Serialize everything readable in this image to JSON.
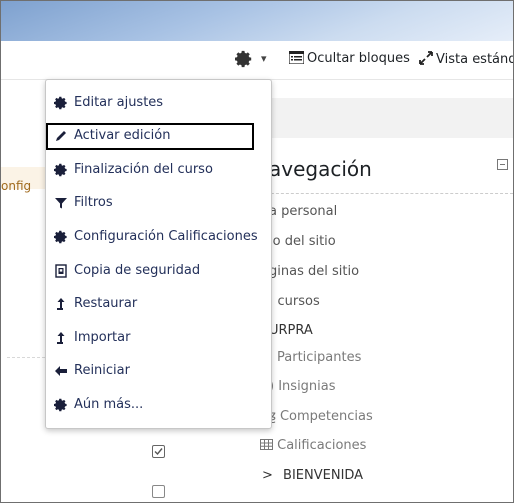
{
  "toolbar": {
    "gear_icon": "gear-icon",
    "hide_blocks_label": "Ocultar bloques",
    "standard_view_label": "Vista estánda"
  },
  "left": {
    "config_fragment": "onfig"
  },
  "menu": {
    "items": [
      {
        "icon": "gear-icon",
        "label": "Editar ajustes"
      },
      {
        "icon": "pencil-icon",
        "label": "Activar edición"
      },
      {
        "icon": "gear-icon",
        "label": "Finalización del curso"
      },
      {
        "icon": "filter-icon",
        "label": "Filtros"
      },
      {
        "icon": "gear-icon",
        "label": "Configuración Calificaciones"
      },
      {
        "icon": "backup-file-icon",
        "label": "Copia de seguridad"
      },
      {
        "icon": "upload-arrow-icon",
        "label": "Restaurar"
      },
      {
        "icon": "upload-arrow-icon",
        "label": "Importar"
      },
      {
        "icon": "arrow-left-icon",
        "label": "Reiniciar"
      },
      {
        "icon": "gear-icon",
        "label": "Aún más..."
      }
    ]
  },
  "navigation": {
    "title": "avegación",
    "items": [
      {
        "label": "a personal"
      },
      {
        "label": "io del sitio"
      },
      {
        "label": "ginas del sitio"
      },
      {
        "label": "; cursos"
      },
      {
        "label": "URPRA"
      },
      {
        "label": "Participantes"
      },
      {
        "label": "Insignias"
      },
      {
        "label": "Competencias"
      },
      {
        "label": "Calificaciones"
      },
      {
        "label": "BIENVENIDA"
      }
    ]
  },
  "colors": {
    "menu_text": "#23305a",
    "header_gradient_start": "#7ea1cf",
    "highlight_border": "#000000"
  }
}
